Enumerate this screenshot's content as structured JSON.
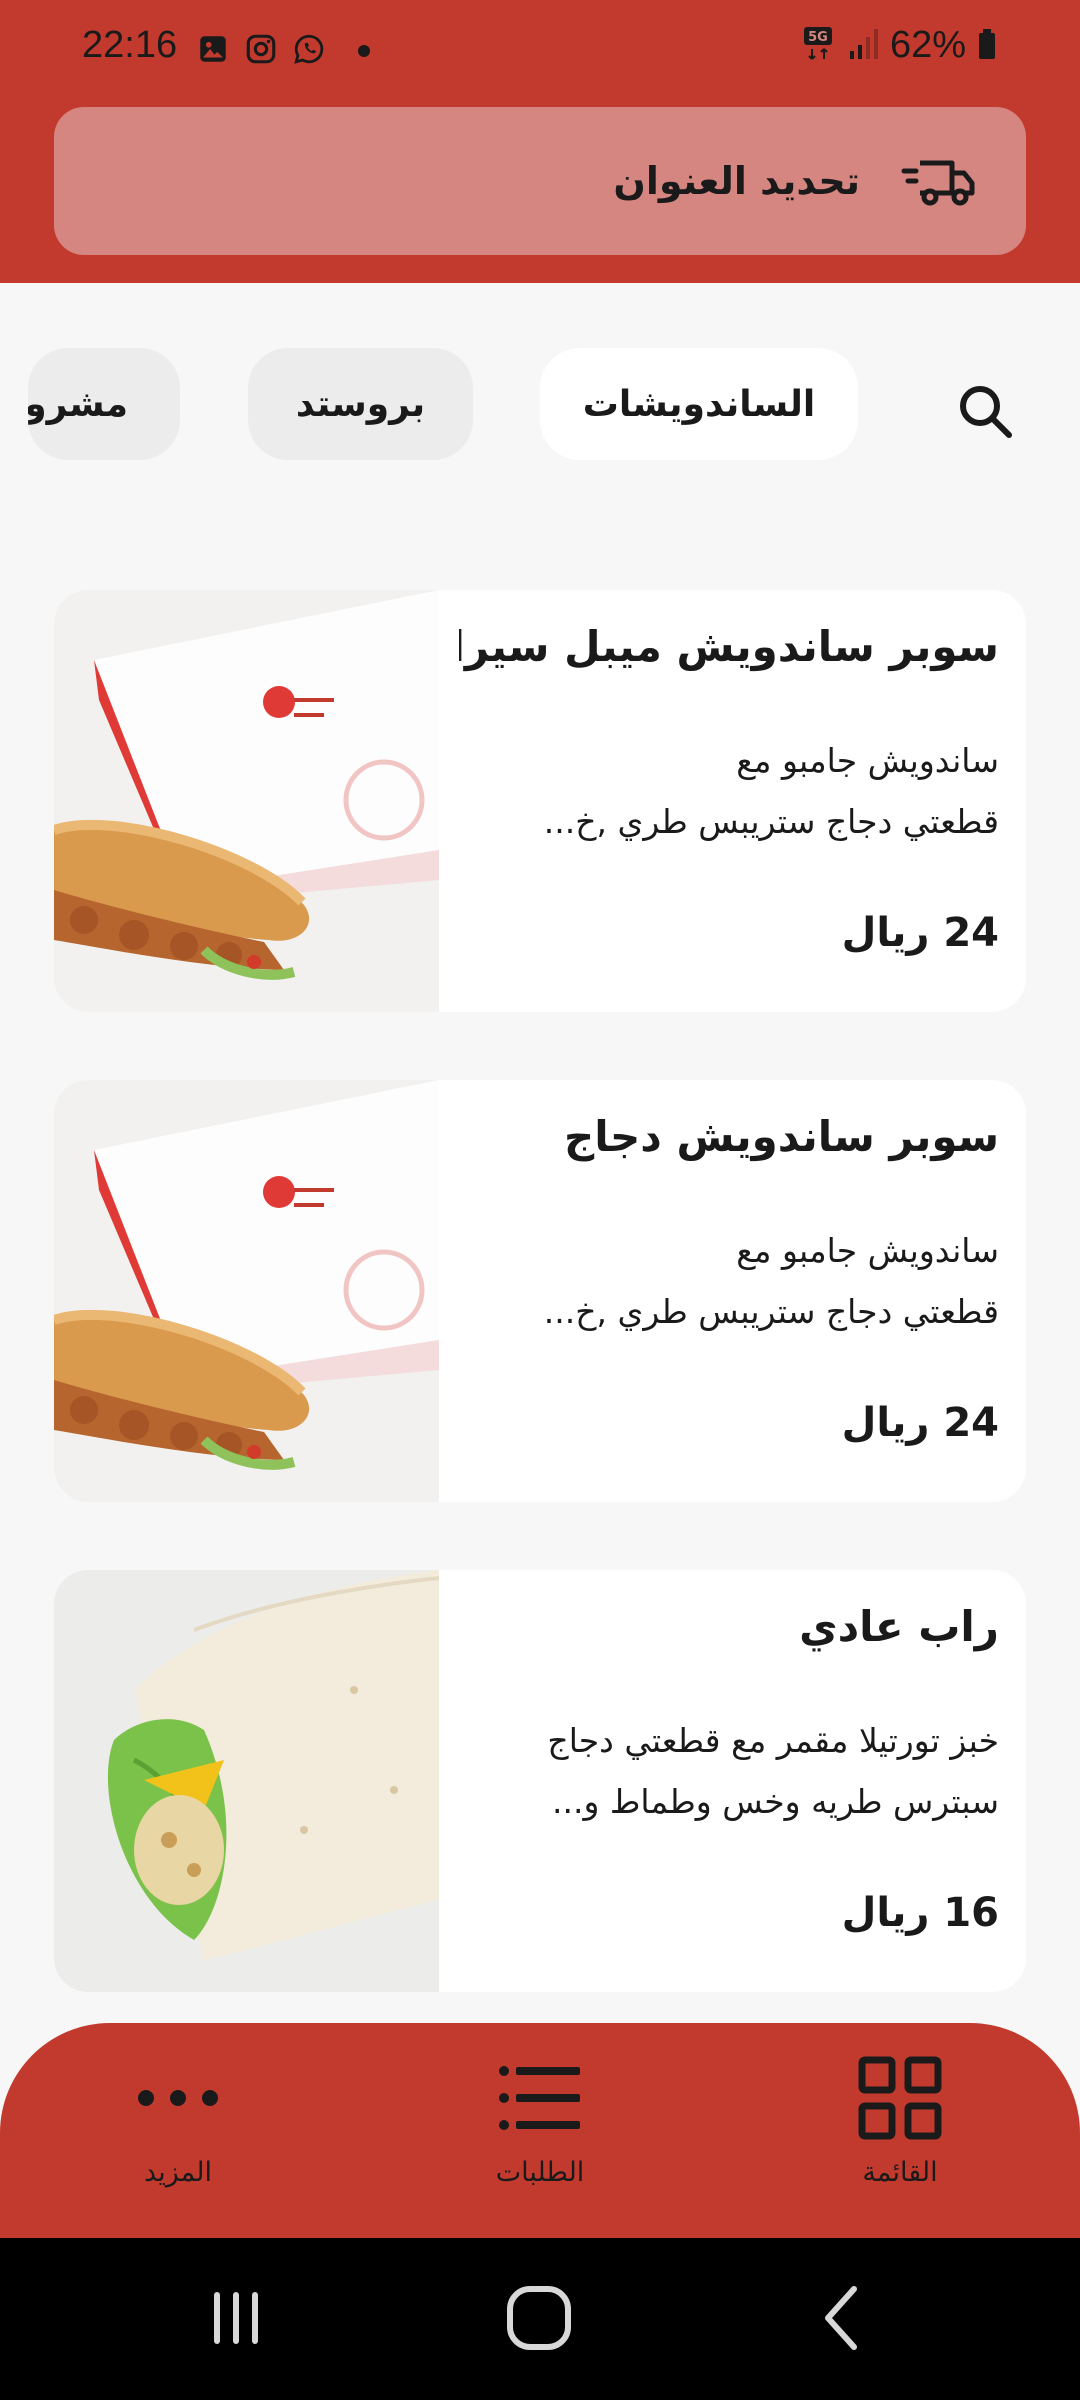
{
  "status_bar": {
    "time": "22:16",
    "battery": "62%",
    "network": "5G",
    "icons_left": [
      "gallery-icon",
      "instagram-icon",
      "whatsapp-icon",
      "dot-icon"
    ],
    "icons_right": [
      "5g-icon",
      "signal-icon",
      "battery-icon"
    ]
  },
  "header": {
    "address_label": "تحديد العنوان",
    "icon": "delivery-truck-icon",
    "color": "#c23a2e",
    "address_bg": "#d68681"
  },
  "categories": {
    "search_icon": "search-icon",
    "items": [
      {
        "label": "الساندويشات",
        "active": true
      },
      {
        "label": "بروستد",
        "active": false
      },
      {
        "label": "مشروب",
        "active": false
      }
    ]
  },
  "products": [
    {
      "title": "سوبر ساندويش ميبل سيرات",
      "desc_line1": "ساندويش جامبو مع",
      "desc_line2": "قطعتي دجاج ستريبس طري ,خ...",
      "price": "24 ريال"
    },
    {
      "title": "سوبر ساندويش دجاج",
      "desc_line1": "ساندويش جامبو مع",
      "desc_line2": "قطعتي دجاج ستريبس طري ,خ...",
      "price": "24 ريال"
    },
    {
      "title": "راب عادي",
      "desc_line1": "خبز تورتيلا مقمر مع قطعتي دجاج",
      "desc_line2": "سبترس طريه وخس وطماط و...",
      "price": "16 ريال"
    }
  ],
  "bottom_nav": {
    "menu_label": "القائمة",
    "orders_label": "الطلبات",
    "more_label": "المزيد"
  },
  "colors": {
    "brand_red": "#c23a2e",
    "page_bg": "#f7f7f7",
    "chip_inactive": "#ececec"
  }
}
